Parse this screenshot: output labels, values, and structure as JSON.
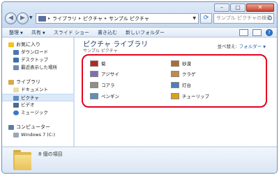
{
  "window": {
    "controls": {
      "minimize": "–",
      "maximize": "□",
      "close": "✕"
    }
  },
  "address_bar": {
    "segments": [
      "ライブラリ",
      "ピクチャ",
      "サンプル ピクチャ"
    ],
    "separator": "▸",
    "search_placeholder": "サンプル ピクチャの検索"
  },
  "toolbar": {
    "items": [
      "整理",
      "共有",
      "スライド ショー",
      "書き込む",
      "新しいフォルダー"
    ],
    "dropdown_items": [
      true,
      true,
      false,
      false,
      false
    ]
  },
  "nav_pane": {
    "favorites": {
      "label": "お気に入り",
      "items": [
        "ダウンロード",
        "デスクトップ",
        "最近表示した場所"
      ]
    },
    "libraries": {
      "label": "ライブラリ",
      "items": [
        "ドキュメント",
        "ピクチャ",
        "ビデオ",
        "ミュージック"
      ],
      "selected": "ピクチャ"
    },
    "computer": {
      "label": "コンピューター",
      "items": [
        "Windows 7 (C:)"
      ]
    }
  },
  "content": {
    "title": "ピクチャ ライブラリ",
    "subtitle": "サンプル ピクチャ",
    "arrange_label": "並べ替え:",
    "arrange_value": "フォルダー",
    "files": [
      {
        "name": "菊",
        "thumb": "#b8261d"
      },
      {
        "name": "砂漠",
        "thumb": "#b06a35"
      },
      {
        "name": "アジサイ",
        "thumb": "#7d6fb0"
      },
      {
        "name": "クラゲ",
        "thumb": "#c28a4a"
      },
      {
        "name": "コアラ",
        "thumb": "#8f8f85"
      },
      {
        "name": "灯台",
        "thumb": "#4d7fb8"
      },
      {
        "name": "ペンギン",
        "thumb": "#5f8fb8"
      },
      {
        "name": "チューリップ",
        "thumb": "#d8a31c"
      }
    ]
  },
  "details": {
    "count": "8 個の項目"
  },
  "colors": {
    "highlight": "#e5001f",
    "accent": "#1e3b6e"
  }
}
